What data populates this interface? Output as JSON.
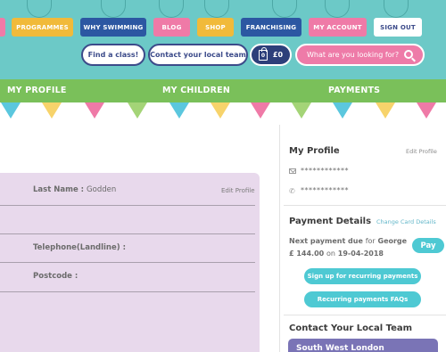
{
  "top_nav": {
    "items": [
      {
        "label": "PROGRAMMES",
        "color": "#f1ba3a"
      },
      {
        "label": "WHY SWIMMING",
        "color": "#2c57a2"
      },
      {
        "label": "BLOG",
        "color": "#ef7aa7"
      },
      {
        "label": "SHOP",
        "color": "#f1ba3a"
      },
      {
        "label": "FRANCHISING",
        "color": "#2c57a2"
      },
      {
        "label": "MY ACCOUNT",
        "color": "#ef7aa7"
      },
      {
        "label": "SIGN OUT",
        "color": "#ffffff"
      }
    ]
  },
  "actions": {
    "find_class": "Find a class!",
    "contact_team": "Contact your local team",
    "basket_count": "0",
    "basket_total": "£0",
    "search_placeholder": "What are you looking for?"
  },
  "section_nav": {
    "my_profile": "MY PROFILE",
    "my_children": "MY CHILDREN",
    "payments": "PAYMENTS"
  },
  "profile_card": {
    "last_name_label": "Last Name :",
    "last_name_value": "Godden",
    "edit_profile": "Edit Profile",
    "telephone_label": "Telephone(Landline) :",
    "postcode_label": "Postcode :"
  },
  "sidebar": {
    "my_profile_title": "My Profile",
    "edit_profile": "Edit Profile",
    "email_masked": "************",
    "phone_masked": "************",
    "payment_details_title": "Payment Details",
    "change_card": "Change Card Details",
    "next_payment_prefix": "Next payment due",
    "next_payment_for": "for",
    "next_payment_name": "George",
    "next_payment_amount": "£ 144.00",
    "next_payment_on": "on",
    "next_payment_date": "19-04-2018",
    "pay_button": "Pay",
    "recurring_signup": "Sign up for recurring payments",
    "recurring_faqs": "Recurring payments FAQs",
    "contact_title": "Contact Your Local Team",
    "local_team_name": "South West London"
  },
  "colors": {
    "header_teal": "#6cc9c7",
    "nav_green": "#7ac05a",
    "accent_teal": "#4ec9d3",
    "navy": "#2d3f7a",
    "pink": "#ee7ba8",
    "card_lilac": "#e8d9ec"
  }
}
